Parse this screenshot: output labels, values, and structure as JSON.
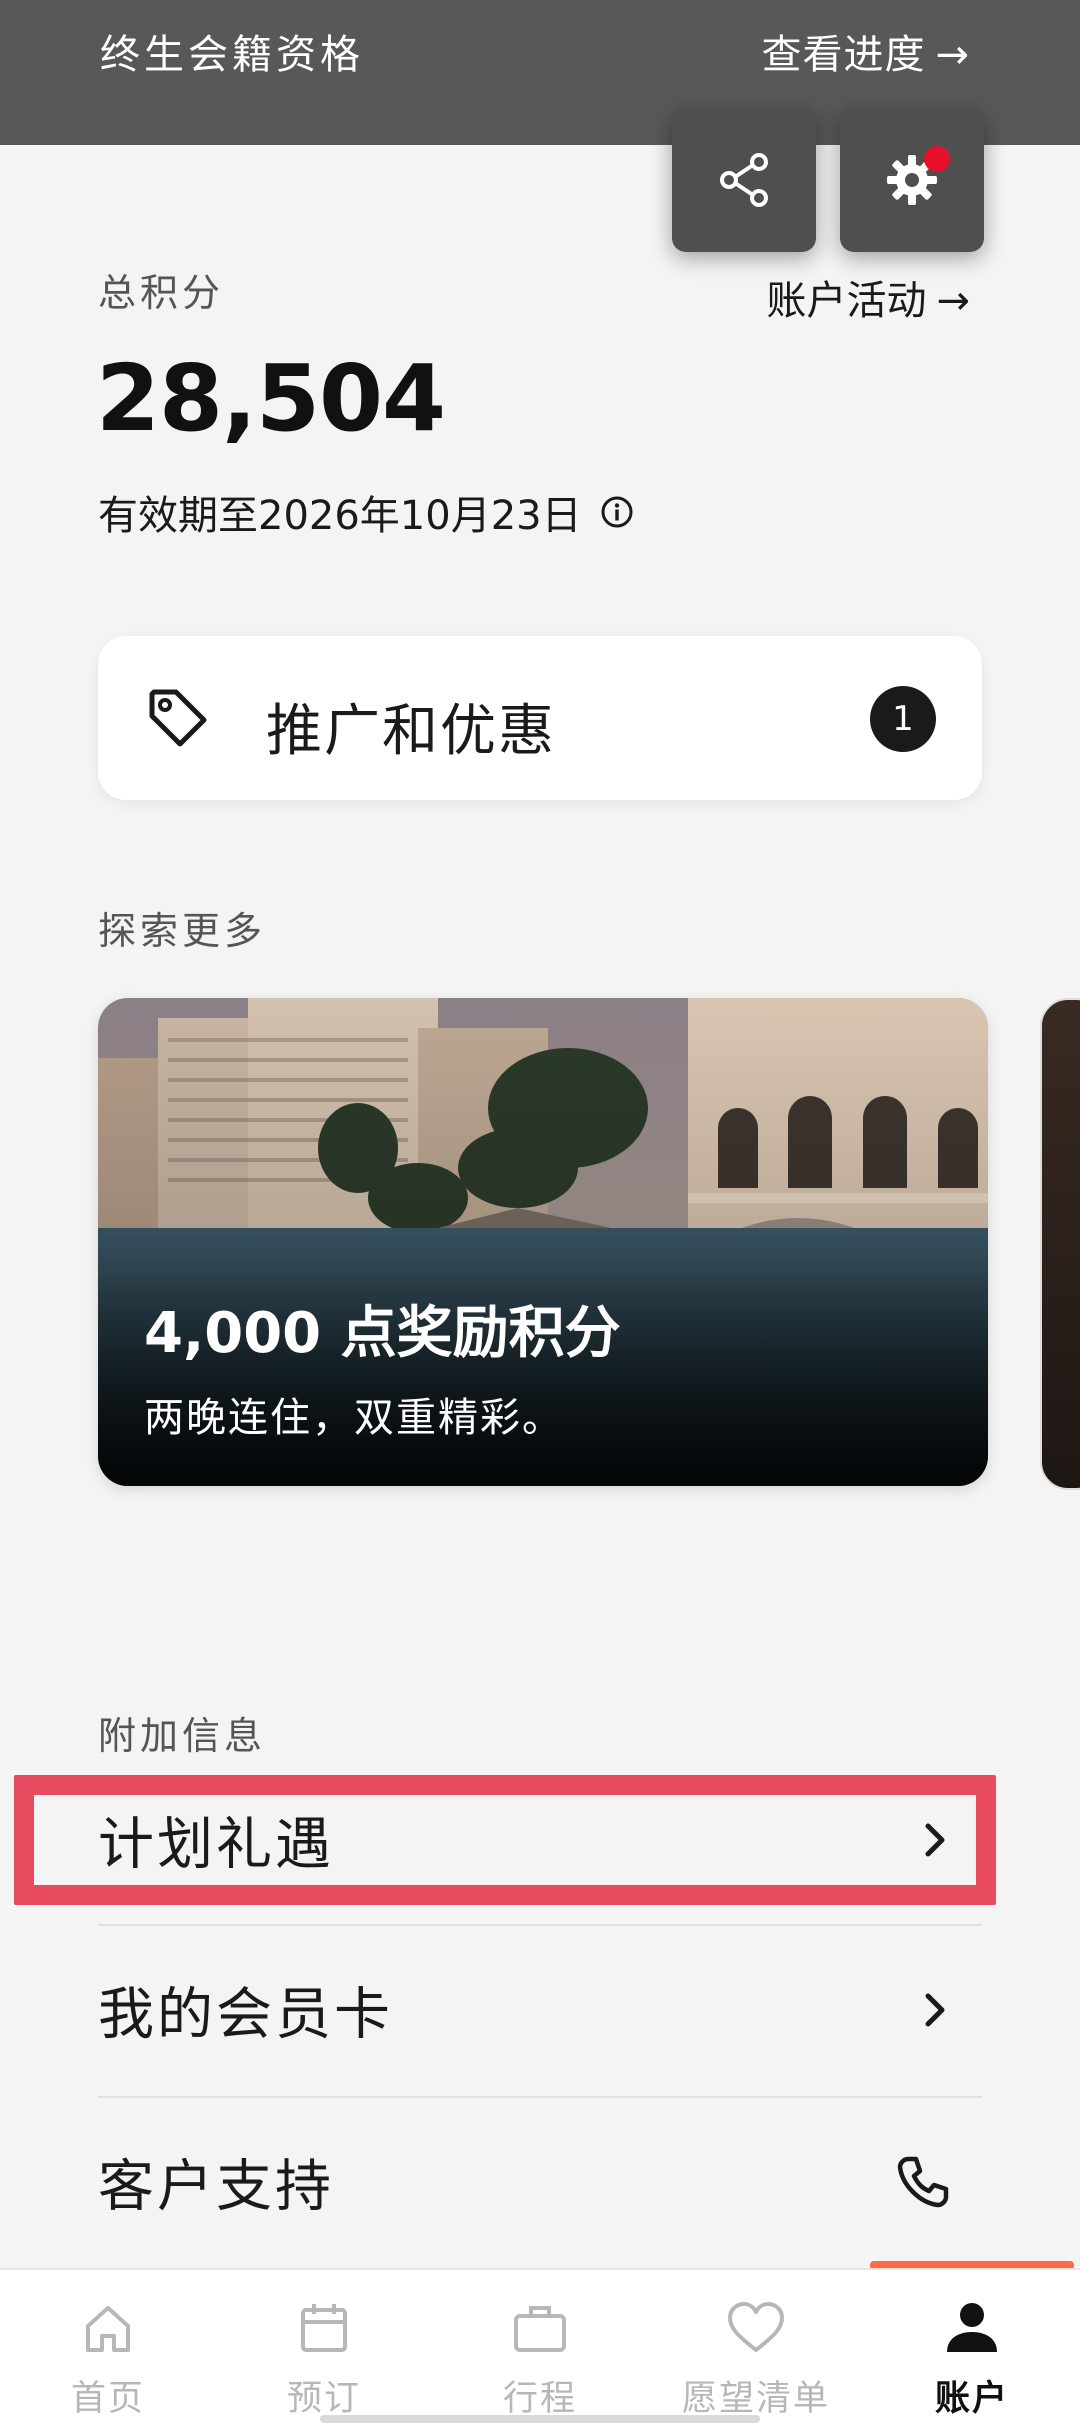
{
  "header": {
    "membership": "终生会籍资格",
    "progress_link": "查看进度"
  },
  "icons": {
    "arrow": "→",
    "share": "share-icon",
    "settings": "gear-icon"
  },
  "points": {
    "label": "总积分",
    "value": "28,504",
    "expiry": "有效期至2026年10月23日",
    "account_activity": "账户活动"
  },
  "promo": {
    "label": "推广和优惠",
    "count": "1"
  },
  "explore": {
    "label": "探索更多",
    "card_title": "4,000 点奖励积分",
    "card_subtitle": "两晚连住，双重精彩。"
  },
  "additional": {
    "label": "附加信息",
    "items": [
      {
        "label": "计划礼遇",
        "icon": "chevron-right-icon"
      },
      {
        "label": "我的会员卡",
        "icon": "chevron-right-icon"
      },
      {
        "label": "客户支持",
        "icon": "phone-icon"
      }
    ]
  },
  "tabs": [
    {
      "label": "首页",
      "icon": "home-icon"
    },
    {
      "label": "预订",
      "icon": "calendar-icon"
    },
    {
      "label": "行程",
      "icon": "briefcase-icon"
    },
    {
      "label": "愿望清单",
      "icon": "heart-icon"
    },
    {
      "label": "账户",
      "icon": "person-icon",
      "active": true
    }
  ],
  "colors": {
    "header_bg": "#585858",
    "notification": "#e8102b",
    "highlight": "#e84a5f",
    "tab_indicator": "#ff6a45"
  }
}
